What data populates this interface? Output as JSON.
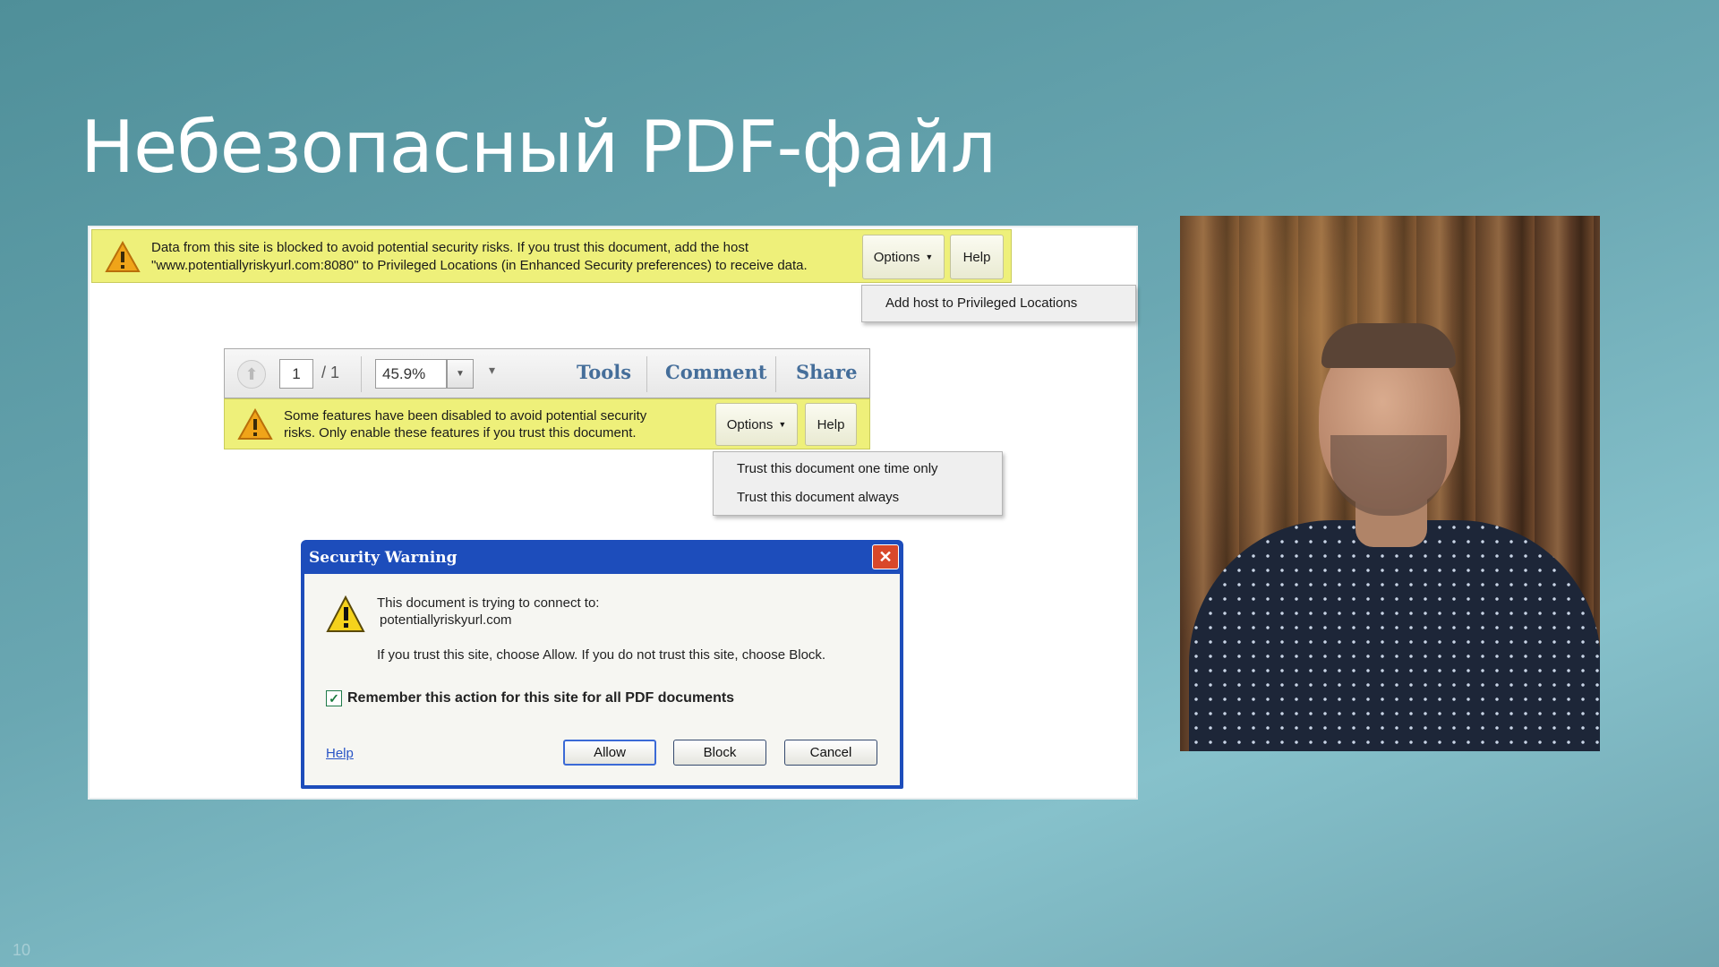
{
  "slide": {
    "title": "Небезопасный PDF-файл",
    "page_number": "10"
  },
  "top_bar": {
    "line1": "Data from this site is blocked to avoid potential security risks. If you trust this document, add the host",
    "line2": "\"www.potentiallyriskyurl.com:8080\" to Privileged Locations (in Enhanced Security preferences) to receive data.",
    "options_label": "Options",
    "help_label": "Help",
    "menu_items": [
      "Add host to Privileged Locations"
    ]
  },
  "toolbar": {
    "page_current": "1",
    "page_total": "/ 1",
    "zoom": "45.9%",
    "tools_label": "Tools",
    "comment_label": "Comment",
    "share_label": "Share"
  },
  "second_bar": {
    "line1": "Some features have been disabled to avoid potential security",
    "line2": "risks. Only enable these features if you trust this document.",
    "options_label": "Options",
    "help_label": "Help",
    "menu_items": [
      "Trust this document one time only",
      "Trust this document always"
    ]
  },
  "dialog": {
    "title": "Security Warning",
    "close_glyph": "✕",
    "message_line1": "This document is trying to connect to:",
    "message_line2": "potentiallyriskyurl.com",
    "message_line3": "If you trust this site, choose Allow. If you do not trust this site, choose Block.",
    "checkbox_label": "Remember this action for this site for all PDF documents",
    "checkbox_checked": true,
    "help_link": "Help",
    "allow_label": "Allow",
    "block_label": "Block",
    "cancel_label": "Cancel"
  },
  "icons": {
    "warning": "warning-icon",
    "up_arrow": "up-arrow-icon",
    "close": "close-icon",
    "dropdown": "chevron-down-icon"
  },
  "colors": {
    "bar_yellow": "#eef07a",
    "dialog_blue": "#1d4dbb",
    "close_red": "#d9482a",
    "toolbar_link": "#456e9a"
  }
}
